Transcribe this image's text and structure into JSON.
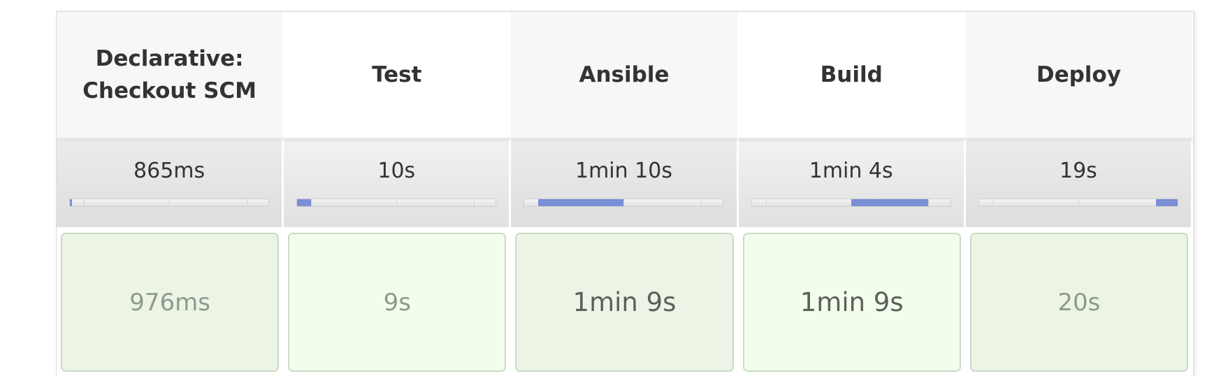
{
  "stages": [
    {
      "name": "Declarative:\nCheckout SCM",
      "avg": "865ms",
      "bar_start": 0.0,
      "bar_width": 0.01,
      "last": "976ms"
    },
    {
      "name": "Test",
      "avg": "10s",
      "bar_start": 0.0,
      "bar_width": 0.07,
      "last": "9s"
    },
    {
      "name": "Ansible",
      "avg": "1min 10s",
      "bar_start": 0.07,
      "bar_width": 0.43,
      "last": "1min 9s"
    },
    {
      "name": "Build",
      "avg": "1min 4s",
      "bar_start": 0.5,
      "bar_width": 0.39,
      "last": "1min 9s"
    },
    {
      "name": "Deploy",
      "avg": "19s",
      "bar_start": 0.89,
      "bar_width": 0.11,
      "last": "20s"
    }
  ],
  "colors": {
    "bar_fill": "#7a8fd6",
    "success_bg_dark": "#ebf4e5",
    "success_bg_light": "#f2fdec",
    "success_border": "#c9dcc6"
  }
}
